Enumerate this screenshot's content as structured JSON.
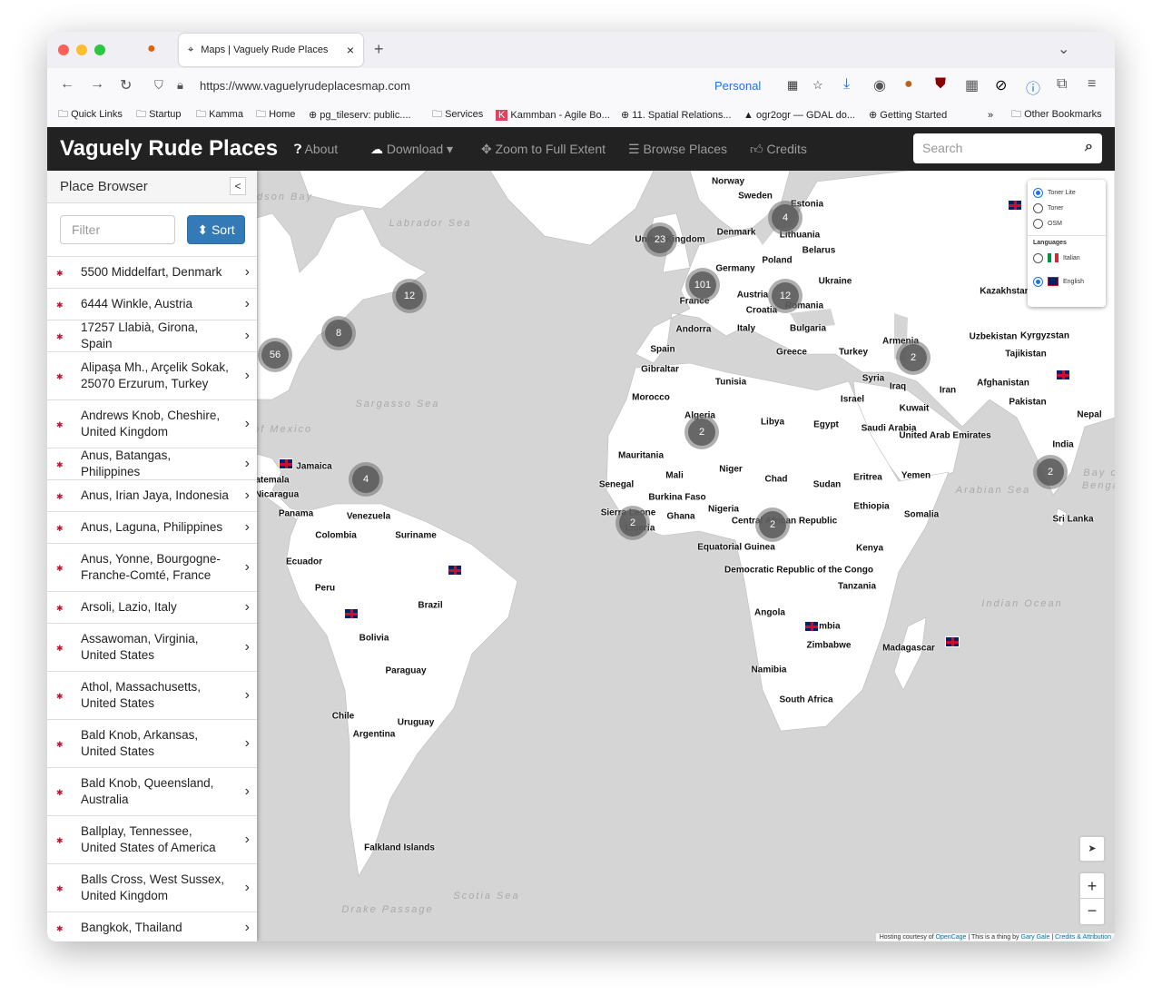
{
  "browser": {
    "tab_title": "Maps | Vaguely Rude Places",
    "url": "https://www.vaguelyrudeplacesmap.com",
    "profile": "Personal",
    "bookmarks": [
      "Quick Links",
      "Startup",
      "Kamma",
      "Home",
      "pg_tileserv: public....",
      "Services",
      "Kammban - Agile Bo...",
      "11. Spatial Relations...",
      "ogr2ogr — GDAL do...",
      "Getting Started"
    ],
    "other_bookmarks": "Other Bookmarks"
  },
  "navbar": {
    "brand": "Vaguely Rude Places",
    "about": "About",
    "download": "Download",
    "zoom_full": "Zoom to Full Extent",
    "browse": "Browse Places",
    "credits": "Credits",
    "search_placeholder": "Search"
  },
  "sidebar": {
    "title": "Place Browser",
    "filter_placeholder": "Filter",
    "sort_label": "Sort",
    "items": [
      "5500 Middelfart, Denmark",
      "6444 Winkle, Austria",
      "17257 Llabià, Girona, Spain",
      "Alipaşa Mh., Arçelik Sokak, 25070 Erzurum, Turkey",
      "Andrews Knob, Cheshire, United Kingdom",
      "Anus, Batangas, Philippines",
      "Anus, Irian Jaya, Indonesia",
      "Anus, Laguna, Philippines",
      "Anus, Yonne, Bourgogne-Franche-Comté, France",
      "Arsoli, Lazio, Italy",
      "Assawoman, Virginia, United States",
      "Athol, Massachusetts, United States",
      "Bald Knob, Arkansas, United States",
      "Bald Knob, Queensland, Australia",
      "Ballplay, Tennessee, United States of America",
      "Balls Cross, West Sussex, United Kingdom",
      "Bangkok, Thailand"
    ]
  },
  "map": {
    "layers": {
      "options": [
        "Toner Lite",
        "Toner",
        "OSM"
      ],
      "selected": "Toner Lite",
      "languages_title": "Languages",
      "languages": [
        "Italian",
        "English"
      ],
      "selected_language": "English"
    },
    "clusters": [
      "23",
      "4",
      "101",
      "12",
      "12",
      "8",
      "56",
      "2",
      "2",
      "4",
      "2",
      "2",
      "2"
    ],
    "countries": [
      "Norway",
      "Sweden",
      "Estonia",
      "United Kingdom",
      "Denmark",
      "Lithuania",
      "Belarus",
      "Germany",
      "Poland",
      "France",
      "Austria",
      "Ukraine",
      "Croatia",
      "Romania",
      "Andorra",
      "Italy",
      "Bulgaria",
      "Spain",
      "Greece",
      "Turkey",
      "Gibraltar",
      "Armenia",
      "Kazakhstan",
      "Uzbekistan",
      "Kyrgyzstan",
      "Tajikistan",
      "Tunisia",
      "Syria",
      "Morocco",
      "Iraq",
      "Iran",
      "Afghanistan",
      "Israel",
      "Kuwait",
      "Pakistan",
      "Algeria",
      "Libya",
      "Egypt",
      "Saudi Arabia",
      "United Arab Emirates",
      "Nepal",
      "India",
      "Mauritania",
      "Mali",
      "Niger",
      "Chad",
      "Sudan",
      "Eritrea",
      "Yemen",
      "Senegal",
      "Burkina Faso",
      "Nigeria",
      "Ethiopia",
      "Somalia",
      "Sierra Leone",
      "Liberia",
      "Ghana",
      "Central African Republic",
      "Equatorial Guinea",
      "Kenya",
      "Democratic Republic of the Congo",
      "Tanzania",
      "Sri Lanka",
      "Angola",
      "Zambia",
      "Zimbabwe",
      "Madagascar",
      "Namibia",
      "South Africa",
      "Jamaica",
      "Guatemala",
      "Nicaragua",
      "Panama",
      "Venezuela",
      "Colombia",
      "Suriname",
      "Ecuador",
      "Peru",
      "Brazil",
      "Bolivia",
      "Paraguay",
      "Chile",
      "Uruguay",
      "Argentina",
      "Falkland Islands"
    ],
    "seas": [
      "Hudson Bay",
      "Labrador Sea",
      "Sargasso Sea",
      "Gulf of Mexico",
      "Arabian Sea",
      "Bay of Bengal",
      "Indian Ocean",
      "Scotia Sea",
      "Drake Passage"
    ],
    "attribution": {
      "prefix": "Hosting courtesy of",
      "opencage": "OpenCage",
      "mid": "| This is a thing by",
      "author": "Gary Gale",
      "credits": "Credits & Attribution"
    }
  },
  "colors": {
    "navbar": "#222222",
    "accent": "#337ab7",
    "ocean": "#d5d5d5",
    "land": "#ffffff",
    "cluster": "#5a5a5a"
  }
}
